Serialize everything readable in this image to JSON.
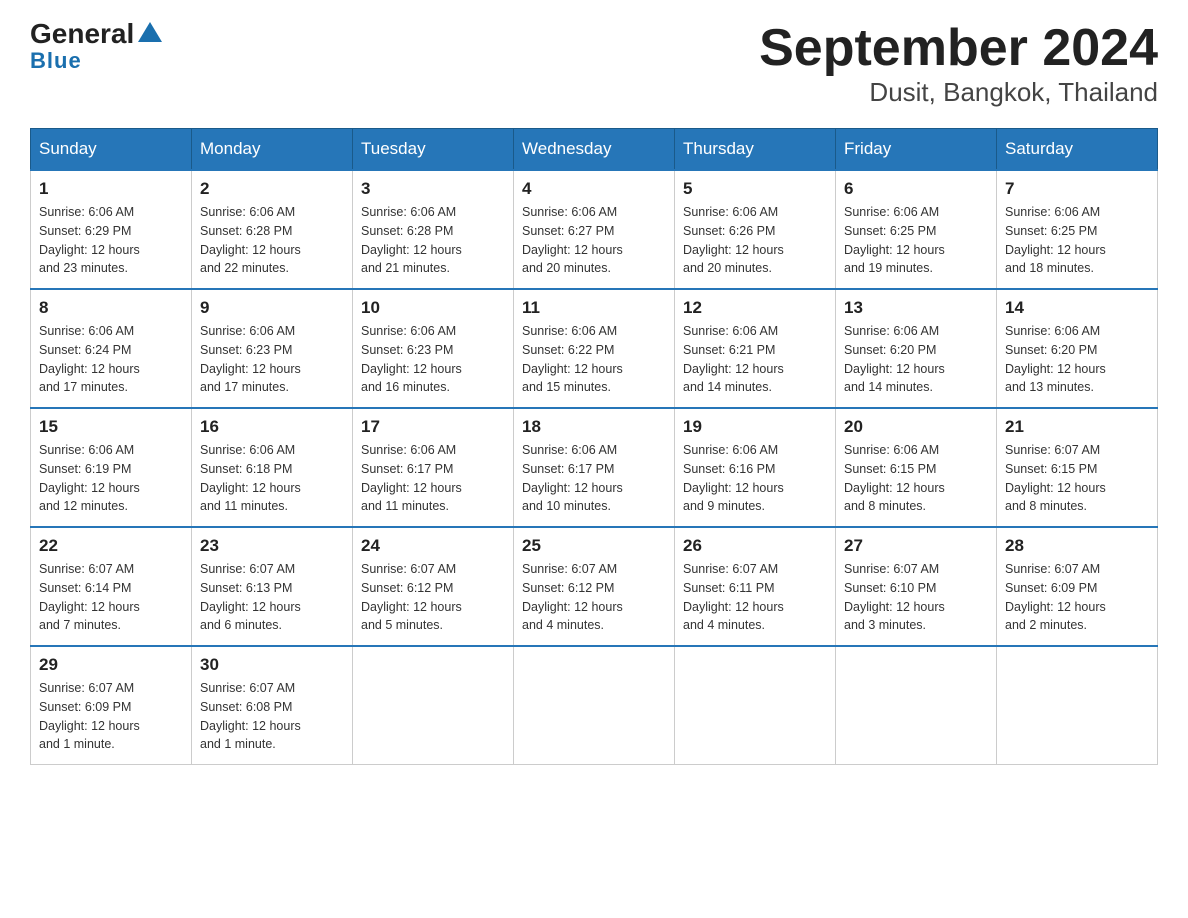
{
  "logo": {
    "line1": "General",
    "line2": "Blue"
  },
  "title": "September 2024",
  "subtitle": "Dusit, Bangkok, Thailand",
  "days_of_week": [
    "Sunday",
    "Monday",
    "Tuesday",
    "Wednesday",
    "Thursday",
    "Friday",
    "Saturday"
  ],
  "weeks": [
    [
      {
        "day": "1",
        "sunrise": "6:06 AM",
        "sunset": "6:29 PM",
        "daylight": "12 hours and 23 minutes."
      },
      {
        "day": "2",
        "sunrise": "6:06 AM",
        "sunset": "6:28 PM",
        "daylight": "12 hours and 22 minutes."
      },
      {
        "day": "3",
        "sunrise": "6:06 AM",
        "sunset": "6:28 PM",
        "daylight": "12 hours and 21 minutes."
      },
      {
        "day": "4",
        "sunrise": "6:06 AM",
        "sunset": "6:27 PM",
        "daylight": "12 hours and 20 minutes."
      },
      {
        "day": "5",
        "sunrise": "6:06 AM",
        "sunset": "6:26 PM",
        "daylight": "12 hours and 20 minutes."
      },
      {
        "day": "6",
        "sunrise": "6:06 AM",
        "sunset": "6:25 PM",
        "daylight": "12 hours and 19 minutes."
      },
      {
        "day": "7",
        "sunrise": "6:06 AM",
        "sunset": "6:25 PM",
        "daylight": "12 hours and 18 minutes."
      }
    ],
    [
      {
        "day": "8",
        "sunrise": "6:06 AM",
        "sunset": "6:24 PM",
        "daylight": "12 hours and 17 minutes."
      },
      {
        "day": "9",
        "sunrise": "6:06 AM",
        "sunset": "6:23 PM",
        "daylight": "12 hours and 17 minutes."
      },
      {
        "day": "10",
        "sunrise": "6:06 AM",
        "sunset": "6:23 PM",
        "daylight": "12 hours and 16 minutes."
      },
      {
        "day": "11",
        "sunrise": "6:06 AM",
        "sunset": "6:22 PM",
        "daylight": "12 hours and 15 minutes."
      },
      {
        "day": "12",
        "sunrise": "6:06 AM",
        "sunset": "6:21 PM",
        "daylight": "12 hours and 14 minutes."
      },
      {
        "day": "13",
        "sunrise": "6:06 AM",
        "sunset": "6:20 PM",
        "daylight": "12 hours and 14 minutes."
      },
      {
        "day": "14",
        "sunrise": "6:06 AM",
        "sunset": "6:20 PM",
        "daylight": "12 hours and 13 minutes."
      }
    ],
    [
      {
        "day": "15",
        "sunrise": "6:06 AM",
        "sunset": "6:19 PM",
        "daylight": "12 hours and 12 minutes."
      },
      {
        "day": "16",
        "sunrise": "6:06 AM",
        "sunset": "6:18 PM",
        "daylight": "12 hours and 11 minutes."
      },
      {
        "day": "17",
        "sunrise": "6:06 AM",
        "sunset": "6:17 PM",
        "daylight": "12 hours and 11 minutes."
      },
      {
        "day": "18",
        "sunrise": "6:06 AM",
        "sunset": "6:17 PM",
        "daylight": "12 hours and 10 minutes."
      },
      {
        "day": "19",
        "sunrise": "6:06 AM",
        "sunset": "6:16 PM",
        "daylight": "12 hours and 9 minutes."
      },
      {
        "day": "20",
        "sunrise": "6:06 AM",
        "sunset": "6:15 PM",
        "daylight": "12 hours and 8 minutes."
      },
      {
        "day": "21",
        "sunrise": "6:07 AM",
        "sunset": "6:15 PM",
        "daylight": "12 hours and 8 minutes."
      }
    ],
    [
      {
        "day": "22",
        "sunrise": "6:07 AM",
        "sunset": "6:14 PM",
        "daylight": "12 hours and 7 minutes."
      },
      {
        "day": "23",
        "sunrise": "6:07 AM",
        "sunset": "6:13 PM",
        "daylight": "12 hours and 6 minutes."
      },
      {
        "day": "24",
        "sunrise": "6:07 AM",
        "sunset": "6:12 PM",
        "daylight": "12 hours and 5 minutes."
      },
      {
        "day": "25",
        "sunrise": "6:07 AM",
        "sunset": "6:12 PM",
        "daylight": "12 hours and 4 minutes."
      },
      {
        "day": "26",
        "sunrise": "6:07 AM",
        "sunset": "6:11 PM",
        "daylight": "12 hours and 4 minutes."
      },
      {
        "day": "27",
        "sunrise": "6:07 AM",
        "sunset": "6:10 PM",
        "daylight": "12 hours and 3 minutes."
      },
      {
        "day": "28",
        "sunrise": "6:07 AM",
        "sunset": "6:09 PM",
        "daylight": "12 hours and 2 minutes."
      }
    ],
    [
      {
        "day": "29",
        "sunrise": "6:07 AM",
        "sunset": "6:09 PM",
        "daylight": "12 hours and 1 minute."
      },
      {
        "day": "30",
        "sunrise": "6:07 AM",
        "sunset": "6:08 PM",
        "daylight": "12 hours and 1 minute."
      },
      null,
      null,
      null,
      null,
      null
    ]
  ],
  "labels": {
    "sunrise": "Sunrise:",
    "sunset": "Sunset:",
    "daylight": "Daylight:"
  }
}
